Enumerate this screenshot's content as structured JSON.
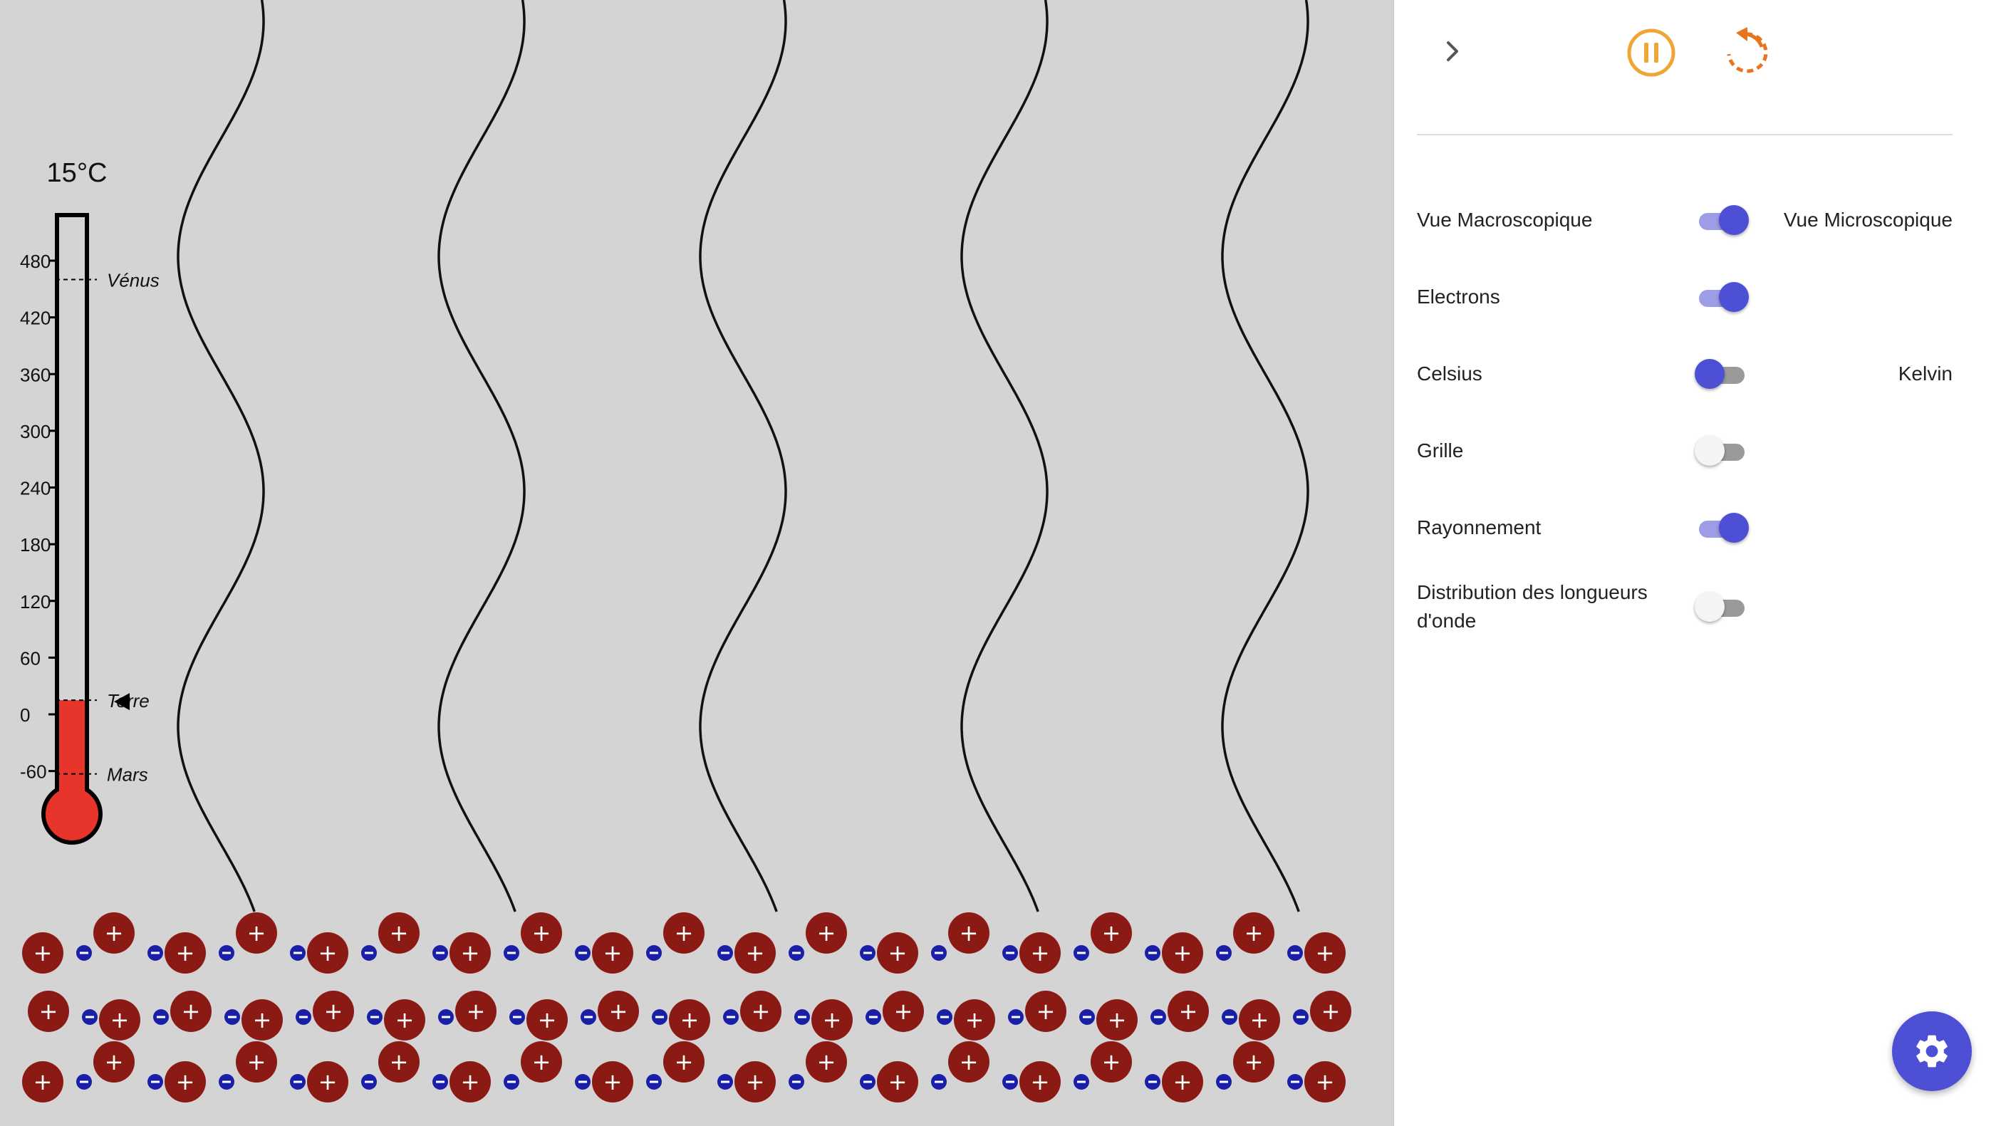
{
  "thermometer": {
    "temperature_readout": "15°C",
    "temperature_value": 15,
    "scale_min": -90,
    "scale_max": 500,
    "ticks": [
      "480",
      "420",
      "360",
      "300",
      "240",
      "180",
      "120",
      "60",
      "0",
      "-60"
    ],
    "tick_values": [
      480,
      420,
      360,
      300,
      240,
      180,
      120,
      60,
      0,
      -60
    ],
    "markers": [
      {
        "label": "Vénus",
        "value": 460
      },
      {
        "label": "Terre",
        "value": 15
      },
      {
        "label": "Mars",
        "value": -63
      }
    ],
    "fill_color": "#e8352b"
  },
  "lattice": {
    "positive_ion_symbol": "+",
    "electron_symbol": "−",
    "ion_color": "#8b1a14",
    "electron_color": "#1a1fa8"
  },
  "controls": {
    "expand_icon": "chevron-right-icon",
    "pause_icon": "pause-icon",
    "reset_icon": "reset-icon",
    "accent_pause": "#f0a537",
    "accent_reset": "#e8741e"
  },
  "settings": {
    "view_left": "Vue Macroscopique",
    "view_right": "Vue Microscopique",
    "electrons": "Electrons",
    "units_left": "Celsius",
    "units_right": "Kelvin",
    "grid": "Grille",
    "radiation": "Rayonnement",
    "wavelength_distribution": "Distribution des longueurs d'onde"
  },
  "toggles": {
    "view_micro": true,
    "electrons": true,
    "kelvin": false,
    "grid": false,
    "radiation": true,
    "wavelength_distribution": false
  },
  "fab_icon": "gear-icon",
  "accent": "#4d4fd4"
}
